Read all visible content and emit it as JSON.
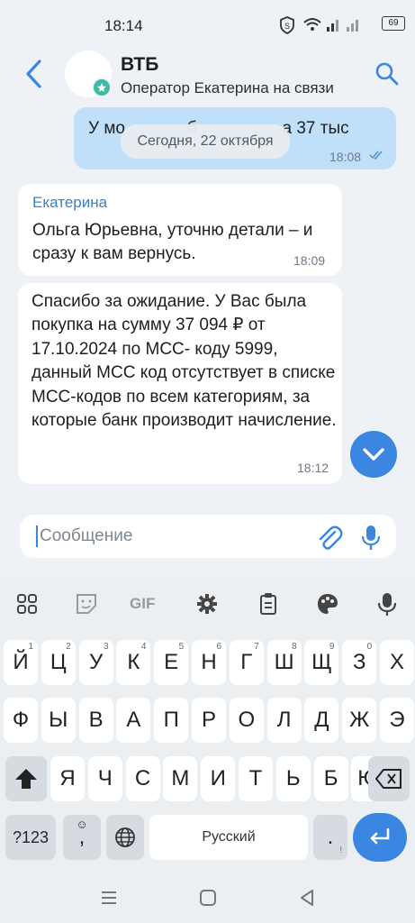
{
  "status_bar": {
    "time": "18:14",
    "battery": "69"
  },
  "header": {
    "title": "ВТБ",
    "subtitle": "Оператор Екатерина на связи"
  },
  "messages": {
    "outgoing": {
      "text": "У мо             б                  а 37 тыс",
      "time": "18:08"
    },
    "date_divider": "Сегодня, 22 октября",
    "incoming1": {
      "sender": "Екатерина",
      "text": "Ольга Юрьевна, уточню детали – и сразу к вам вернусь.",
      "time": "18:09"
    },
    "incoming2": {
      "text": "Спасибо за ожидание.  У Вас была покупка на сумму  37 094 ₽ от 17.10.2024 по МСС- коду 5999, данный МСС код отсутствует в списке МСС-кодов по всем категориям, за которые банк производит начисление.",
      "time": "18:12"
    }
  },
  "composer": {
    "placeholder": "Сообщение",
    "value": ""
  },
  "keyboard": {
    "toolbar": [
      "apps-icon",
      "sticker-icon",
      "GIF",
      "settings-icon",
      "clipboard-icon",
      "palette-icon",
      "mic-icon"
    ],
    "gif_label": "GIF",
    "row1": [
      "Й",
      "Ц",
      "У",
      "К",
      "Е",
      "Н",
      "Г",
      "Ш",
      "Щ",
      "З",
      "Х"
    ],
    "row1_hints": [
      "1",
      "2",
      "3",
      "4",
      "5",
      "6",
      "7",
      "8",
      "9",
      "0",
      ""
    ],
    "row2": [
      "Ф",
      "Ы",
      "В",
      "А",
      "П",
      "Р",
      "О",
      "Л",
      "Д",
      "Ж",
      "Э"
    ],
    "row3": [
      "Я",
      "Ч",
      "С",
      "М",
      "И",
      "Т",
      "Ь",
      "Б",
      "Ю"
    ],
    "num_label": "?123",
    "emoji_comma": ",",
    "space_label": "Русский",
    "period": "."
  },
  "colors": {
    "accent": "#3a86e0",
    "outgoing_bubble": "#bfe0f8",
    "online": "#3fb9a5"
  }
}
